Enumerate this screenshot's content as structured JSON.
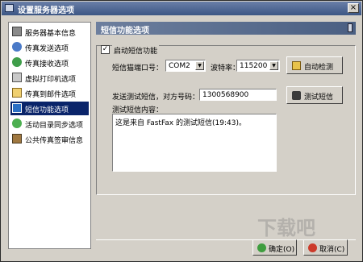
{
  "window": {
    "title": "设置服务器选项"
  },
  "sidebar": {
    "items": [
      {
        "label": "服务器基本信息",
        "icon": "server-icon"
      },
      {
        "label": "传真发送选项",
        "icon": "fax-send-icon"
      },
      {
        "label": "传真接收选项",
        "icon": "fax-receive-icon"
      },
      {
        "label": "虚拟打印机选项",
        "icon": "printer-icon"
      },
      {
        "label": "传真到邮件选项",
        "icon": "mail-icon"
      },
      {
        "label": "短信功能选项",
        "icon": "sms-icon",
        "selected": true
      },
      {
        "label": "活动目录同步选项",
        "icon": "sync-icon"
      },
      {
        "label": "公共传真签审信息",
        "icon": "tree-icon"
      }
    ]
  },
  "panel": {
    "title": "短信功能选项",
    "enable_label": "启动短信功能",
    "enable_checked": "✓",
    "port_label": "短信猫端口号：",
    "port_value": "COM2",
    "baud_label": "波特率：",
    "baud_value": "115200",
    "auto_detect_label": "自动检测",
    "test_send_label": "发送测试短信，对方号码：",
    "phone_value": "1300568900",
    "test_sms_button": "测试短信",
    "content_label": "测试短信内容：",
    "content_value": "这是来自 FastFax 的测试短信(19:43)。"
  },
  "footer": {
    "ok_label": "确定(O)",
    "cancel_label": "取消(C)"
  },
  "watermark": "下载吧"
}
